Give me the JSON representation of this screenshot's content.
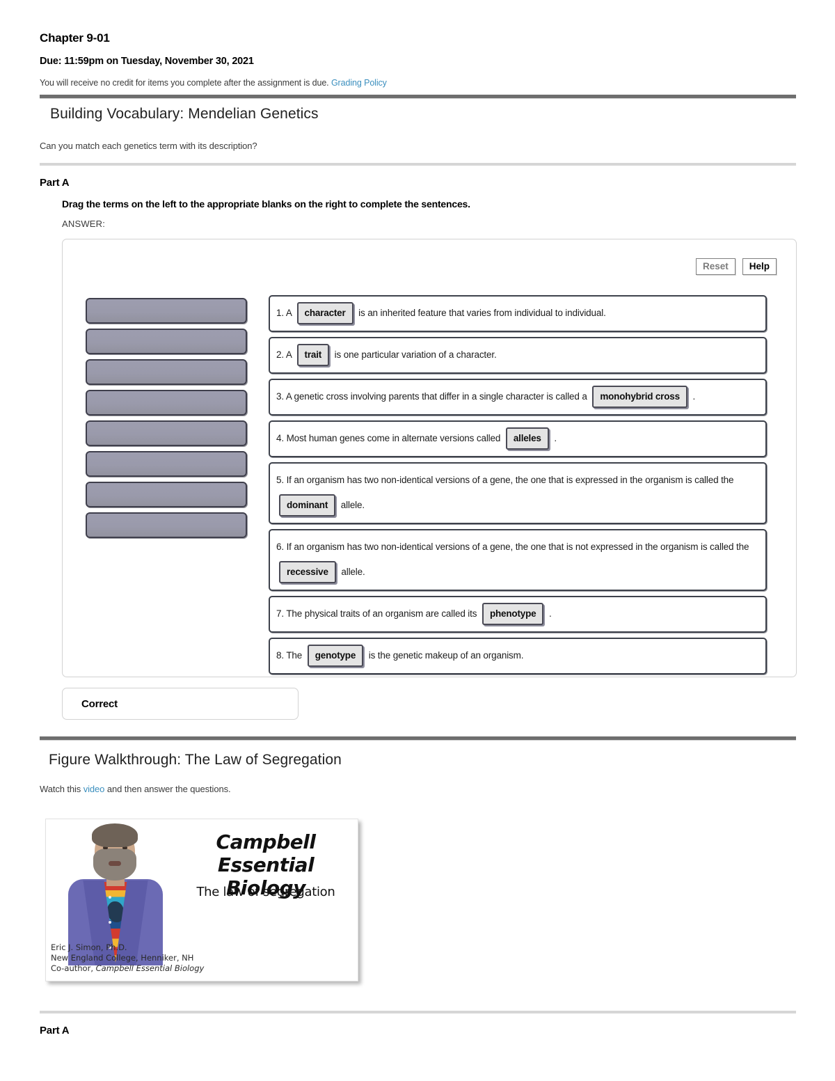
{
  "assignment": {
    "title": "Chapter 9-01",
    "due": "Due: 11:59pm on Tuesday, November 30, 2021",
    "credit_note": "You will receive no credit for items you complete after the assignment is due.",
    "grading_policy_link": "Grading Policy"
  },
  "sections": [
    {
      "heading": "Building Vocabulary: Mendelian Genetics",
      "intro": "Can you match each genetics term with its description?",
      "part_label": "Part A",
      "prompt": "Drag the terms on the left to the appropriate blanks on the right to complete the sentences.",
      "answer_label": "ANSWER:",
      "status": "Correct"
    },
    {
      "heading": "Figure Walkthrough: The Law of Segregation",
      "intro_before": "Watch this ",
      "intro_link": "video",
      "intro_after": " and then answer the questions.",
      "part_label": "Part A"
    }
  ],
  "dnd": {
    "reset_label": "Reset",
    "help_label": "Help",
    "bank_slots": 8,
    "rows": [
      {
        "number": "1.",
        "before": "A",
        "chip": "character",
        "after": "is an inherited feature that varies from individual to individual."
      },
      {
        "number": "2.",
        "before": "A",
        "chip": "trait",
        "after": "is one particular variation of a character."
      },
      {
        "number": "3.",
        "before": "A genetic cross involving parents that differ in a single character is called a",
        "chip": "monohybrid cross",
        "after": "."
      },
      {
        "number": "4.",
        "before": "Most human genes come in alternate versions called",
        "chip": "alleles",
        "after": "."
      },
      {
        "number": "5.",
        "before": "If an organism has two non-identical versions of a gene, the one that is expressed in the organism is called the",
        "chip": "dominant",
        "after": "allele."
      },
      {
        "number": "6.",
        "before": "If an organism has two non-identical versions of a gene, the one that is not expressed in the organism is called the",
        "chip": "recessive",
        "after": "allele."
      },
      {
        "number": "7.",
        "before": "The physical traits of an organism are called its",
        "chip": "phenotype",
        "after": "."
      },
      {
        "number": "8.",
        "before": "The",
        "chip": "genotype",
        "after": "is the genetic makeup of an organism."
      }
    ]
  },
  "video_thumbnail": {
    "title_line1": "Campbell",
    "title_line2": "Essential Biology",
    "subtitle": "The law of segregation",
    "credit_line1": "Eric J. Simon, Ph.D.",
    "credit_line2": "New England College, Henniker, NH",
    "credit_line3_prefix": "Co-author, ",
    "credit_line3_italic": "Campbell Essential Biology"
  },
  "colors": {
    "link": "#3b8fbe",
    "rule_dark": "#6e6e6e",
    "rule_light": "#d6d6d6",
    "slot_fill": "#9a9aab",
    "chip_fill": "#e4e4e4"
  }
}
